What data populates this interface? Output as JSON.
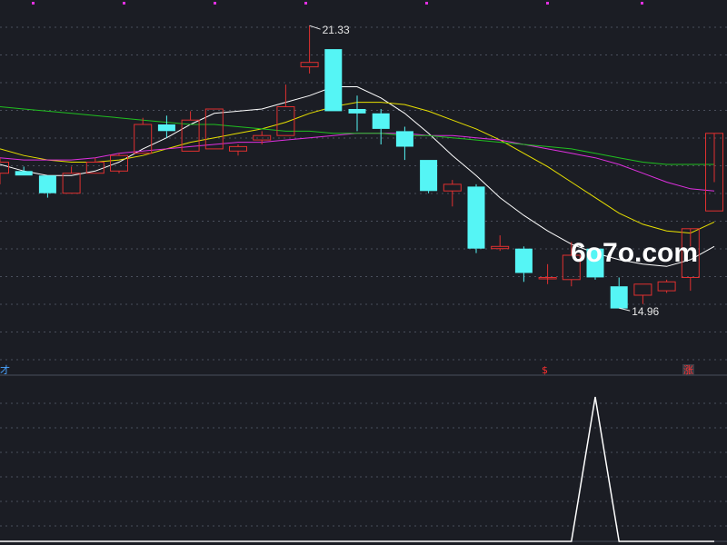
{
  "watermark": "6o7o.com",
  "markers": {
    "left": "才",
    "sell": "$",
    "rise": "涨"
  },
  "colors": {
    "background": "#1b1d24",
    "grid": "#4a4f5c",
    "up": "#e03030",
    "down": "#55f5f5",
    "ma_fast": "#ffffff",
    "ma_mid": "#e8e000",
    "ma_slow": "#e030e0",
    "ma_long": "#20c020",
    "indicator": "#ffffff",
    "top_dots": "#e030e0"
  },
  "chart_data": [
    {
      "type": "candlestick",
      "ylim": [
        14.0,
        21.6
      ],
      "annotations": [
        {
          "label": "21.33",
          "index": 13,
          "value": 21.33
        },
        {
          "label": "14.96",
          "index": 26,
          "value": 14.96
        }
      ],
      "candles": [
        {
          "open": 18.0,
          "high": 18.35,
          "low": 17.75,
          "close": 18.25
        },
        {
          "open": 18.05,
          "high": 18.15,
          "low": 17.95,
          "close": 17.95
        },
        {
          "open": 17.95,
          "high": 17.95,
          "low": 17.45,
          "close": 17.55
        },
        {
          "open": 17.55,
          "high": 18.15,
          "low": 17.55,
          "close": 18.0
        },
        {
          "open": 18.0,
          "high": 18.35,
          "low": 18.0,
          "close": 18.25
        },
        {
          "open": 18.05,
          "high": 18.45,
          "low": 18.0,
          "close": 18.4
        },
        {
          "open": 18.45,
          "high": 19.25,
          "low": 18.45,
          "close": 19.1
        },
        {
          "open": 19.1,
          "high": 19.3,
          "low": 18.8,
          "close": 18.95
        },
        {
          "open": 18.5,
          "high": 19.4,
          "low": 18.5,
          "close": 19.2
        },
        {
          "open": 18.55,
          "high": 19.45,
          "low": 18.55,
          "close": 19.45
        },
        {
          "open": 18.5,
          "high": 18.65,
          "low": 18.4,
          "close": 18.6
        },
        {
          "open": 18.75,
          "high": 18.95,
          "low": 18.65,
          "close": 18.85
        },
        {
          "open": 18.85,
          "high": 20.0,
          "low": 18.85,
          "close": 19.5
        },
        {
          "open": 20.4,
          "high": 21.33,
          "low": 20.25,
          "close": 20.5
        },
        {
          "open": 20.8,
          "high": 20.8,
          "low": 19.4,
          "close": 19.4
        },
        {
          "open": 19.45,
          "high": 19.75,
          "low": 18.95,
          "close": 19.35
        },
        {
          "open": 19.35,
          "high": 19.45,
          "low": 18.65,
          "close": 19.0
        },
        {
          "open": 18.95,
          "high": 19.05,
          "low": 18.3,
          "close": 18.6
        },
        {
          "open": 18.3,
          "high": 18.3,
          "low": 17.55,
          "close": 17.6
        },
        {
          "open": 17.6,
          "high": 17.85,
          "low": 17.25,
          "close": 17.75
        },
        {
          "open": 17.7,
          "high": 17.75,
          "low": 16.2,
          "close": 16.3
        },
        {
          "open": 16.3,
          "high": 16.6,
          "low": 16.25,
          "close": 16.35
        },
        {
          "open": 16.3,
          "high": 16.35,
          "low": 15.55,
          "close": 15.75
        },
        {
          "open": 15.65,
          "high": 15.95,
          "low": 15.5,
          "close": 15.65
        },
        {
          "open": 15.6,
          "high": 16.45,
          "low": 15.45,
          "close": 16.15
        },
        {
          "open": 16.3,
          "high": 16.3,
          "low": 15.6,
          "close": 15.65
        },
        {
          "open": 15.45,
          "high": 15.65,
          "low": 14.96,
          "close": 14.95
        },
        {
          "open": 15.25,
          "high": 15.5,
          "low": 15.05,
          "close": 15.5
        },
        {
          "open": 15.35,
          "high": 15.6,
          "low": 15.3,
          "close": 15.55
        },
        {
          "open": 15.65,
          "high": 16.35,
          "low": 15.35,
          "close": 16.75
        },
        {
          "open": 17.15,
          "high": 17.8,
          "low": 17.15,
          "close": 18.9
        }
      ],
      "series": [
        {
          "values": [
            18.2,
            18.05,
            17.95,
            17.95,
            18.05,
            18.25,
            18.55,
            18.8,
            19.1,
            19.35,
            19.4,
            19.45,
            19.6,
            19.75,
            19.95,
            19.95,
            19.7,
            19.35,
            18.9,
            18.4,
            17.95,
            17.45,
            17.05,
            16.7,
            16.4,
            16.2,
            16.05,
            15.95,
            15.9,
            16.05,
            16.35
          ]
        },
        {
          "values": [
            18.55,
            18.4,
            18.3,
            18.25,
            18.25,
            18.3,
            18.4,
            18.55,
            18.7,
            18.8,
            18.9,
            19.0,
            19.15,
            19.35,
            19.5,
            19.6,
            19.6,
            19.55,
            19.4,
            19.2,
            19.0,
            18.75,
            18.45,
            18.15,
            17.8,
            17.45,
            17.1,
            16.85,
            16.7,
            16.65,
            16.9
          ]
        },
        {
          "values": [
            18.35,
            18.3,
            18.3,
            18.3,
            18.35,
            18.45,
            18.5,
            18.55,
            18.6,
            18.65,
            18.7,
            18.7,
            18.75,
            18.8,
            18.85,
            18.9,
            18.9,
            18.9,
            18.85,
            18.85,
            18.8,
            18.75,
            18.65,
            18.55,
            18.45,
            18.35,
            18.2,
            18.0,
            17.8,
            17.65,
            17.6
          ]
        },
        {
          "values": [
            19.5,
            19.45,
            19.4,
            19.35,
            19.3,
            19.25,
            19.2,
            19.15,
            19.1,
            19.1,
            19.05,
            19.0,
            18.95,
            18.95,
            18.9,
            18.9,
            18.9,
            18.85,
            18.85,
            18.8,
            18.75,
            18.7,
            18.65,
            18.6,
            18.55,
            18.45,
            18.35,
            18.25,
            18.2,
            18.2,
            18.2
          ]
        }
      ]
    },
    {
      "type": "line",
      "values": [
        0,
        0,
        0,
        0,
        0,
        0,
        0,
        0,
        0,
        0,
        0,
        0,
        0,
        0,
        0,
        0,
        0,
        0,
        0,
        0,
        0,
        0,
        0,
        0,
        0,
        1,
        0,
        0,
        0,
        0,
        0
      ],
      "ylim": [
        0,
        1
      ]
    }
  ]
}
